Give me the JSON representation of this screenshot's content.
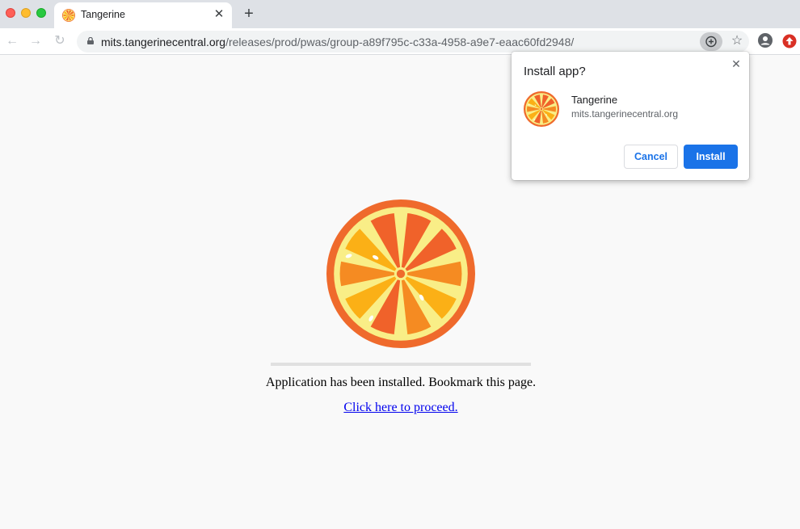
{
  "tab": {
    "title": "Tangerine",
    "close_glyph": "✕"
  },
  "toolbar": {
    "back_glyph": "←",
    "forward_glyph": "→",
    "reload_glyph": "↻",
    "newtab_glyph": "+",
    "star_glyph": "☆",
    "url_host": "mits.tangerinecentral.org",
    "url_path": "/releases/prod/pwas/group-a89f795c-c33a-4958-a9e7-eaac60fd2948/"
  },
  "dialog": {
    "title": "Install app?",
    "close_glyph": "✕",
    "app_name": "Tangerine",
    "app_origin": "mits.tangerinecentral.org",
    "cancel_label": "Cancel",
    "install_label": "Install"
  },
  "page": {
    "message": "Application has been installed. Bookmark this page.",
    "link_text": "Click here to proceed.",
    "progress": 1.0
  },
  "icons": {
    "favicon": "orange-slice-icon",
    "install": "install-app-icon",
    "star": "bookmark-star-icon",
    "profile": "profile-icon",
    "extension": "extension-update-icon"
  },
  "colors": {
    "accent": "#1a73e8",
    "orange_rind": "#ef6a2c",
    "orange_pith": "#f9ee87",
    "segment_dark": "#f0622a",
    "segment_mid": "#f58b22",
    "segment_light": "#fbb016"
  }
}
